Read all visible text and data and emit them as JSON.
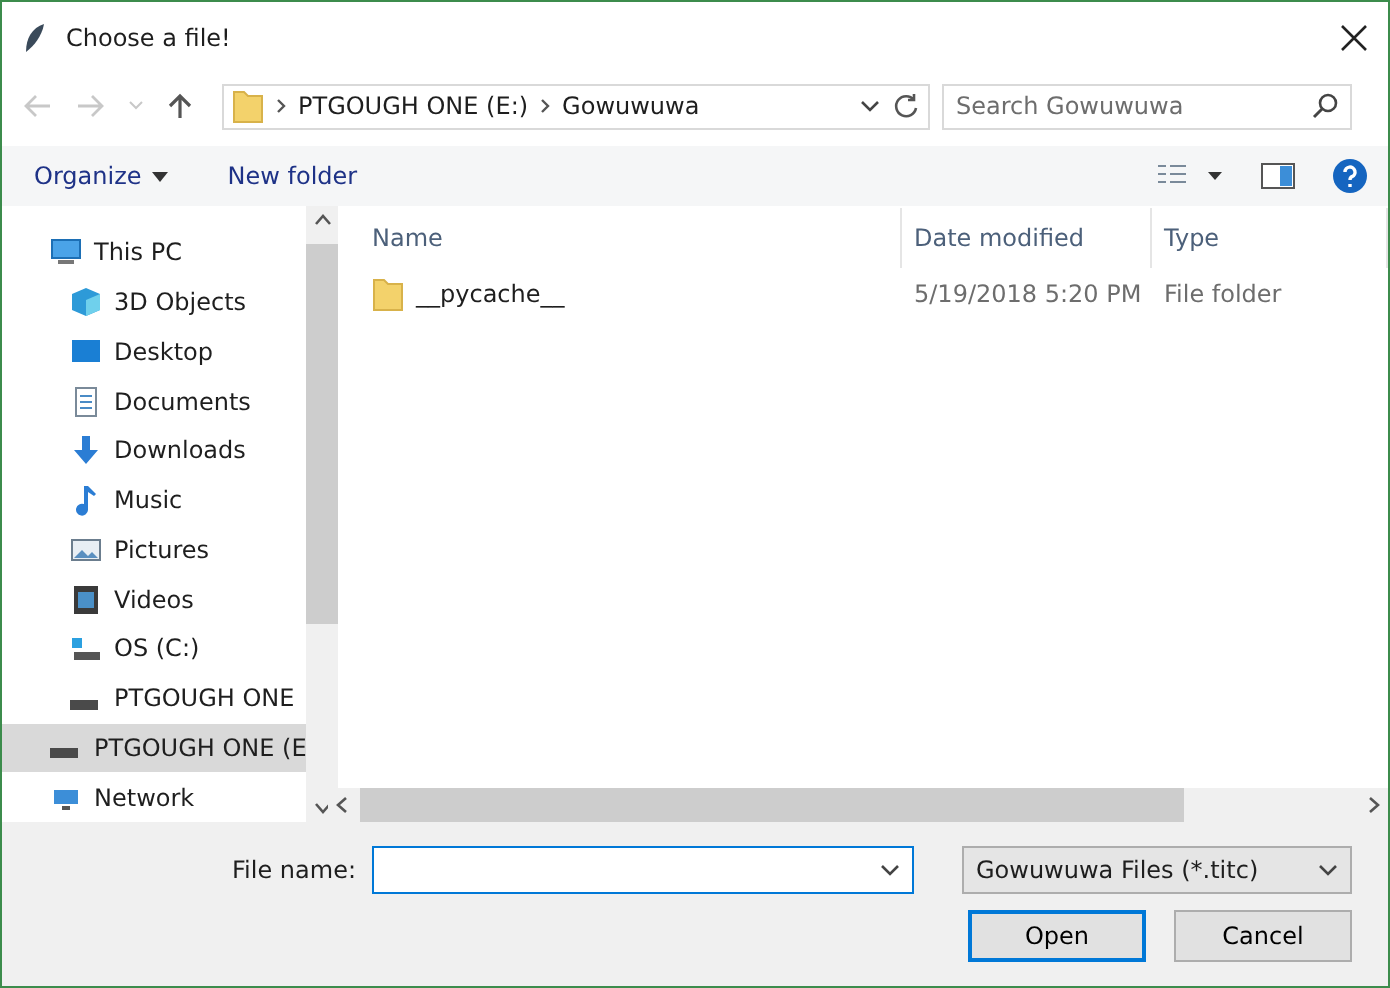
{
  "window": {
    "title": "Choose a file!"
  },
  "address": {
    "segments": [
      "PTGOUGH ONE (E:)",
      "Gowuwuwa"
    ],
    "search_placeholder": "Search Gowuwuwa"
  },
  "toolbar": {
    "organize": "Organize",
    "new_folder": "New folder"
  },
  "sidebar": {
    "items": [
      {
        "label": "This PC",
        "selected": false,
        "children": [
          {
            "label": "3D Objects",
            "selected": false
          },
          {
            "label": "Desktop",
            "selected": false
          },
          {
            "label": "Documents",
            "selected": false
          },
          {
            "label": "Downloads",
            "selected": false
          },
          {
            "label": "Music",
            "selected": false
          },
          {
            "label": "Pictures",
            "selected": false
          },
          {
            "label": "Videos",
            "selected": false
          },
          {
            "label": "OS (C:)",
            "selected": false
          },
          {
            "label": "PTGOUGH ONE",
            "selected": false
          }
        ]
      },
      {
        "label": "PTGOUGH ONE (E",
        "selected": true
      },
      {
        "label": "Network",
        "selected": false
      }
    ]
  },
  "table": {
    "columns": [
      "Name",
      "Date modified",
      "Type"
    ],
    "rows": [
      {
        "name": "__pycache__",
        "date": "5/19/2018 5:20 PM",
        "type": "File folder"
      }
    ]
  },
  "footer": {
    "file_name_label": "File name:",
    "filter": "Gowuwuwa Files (*.titc)",
    "open": "Open",
    "cancel": "Cancel"
  }
}
